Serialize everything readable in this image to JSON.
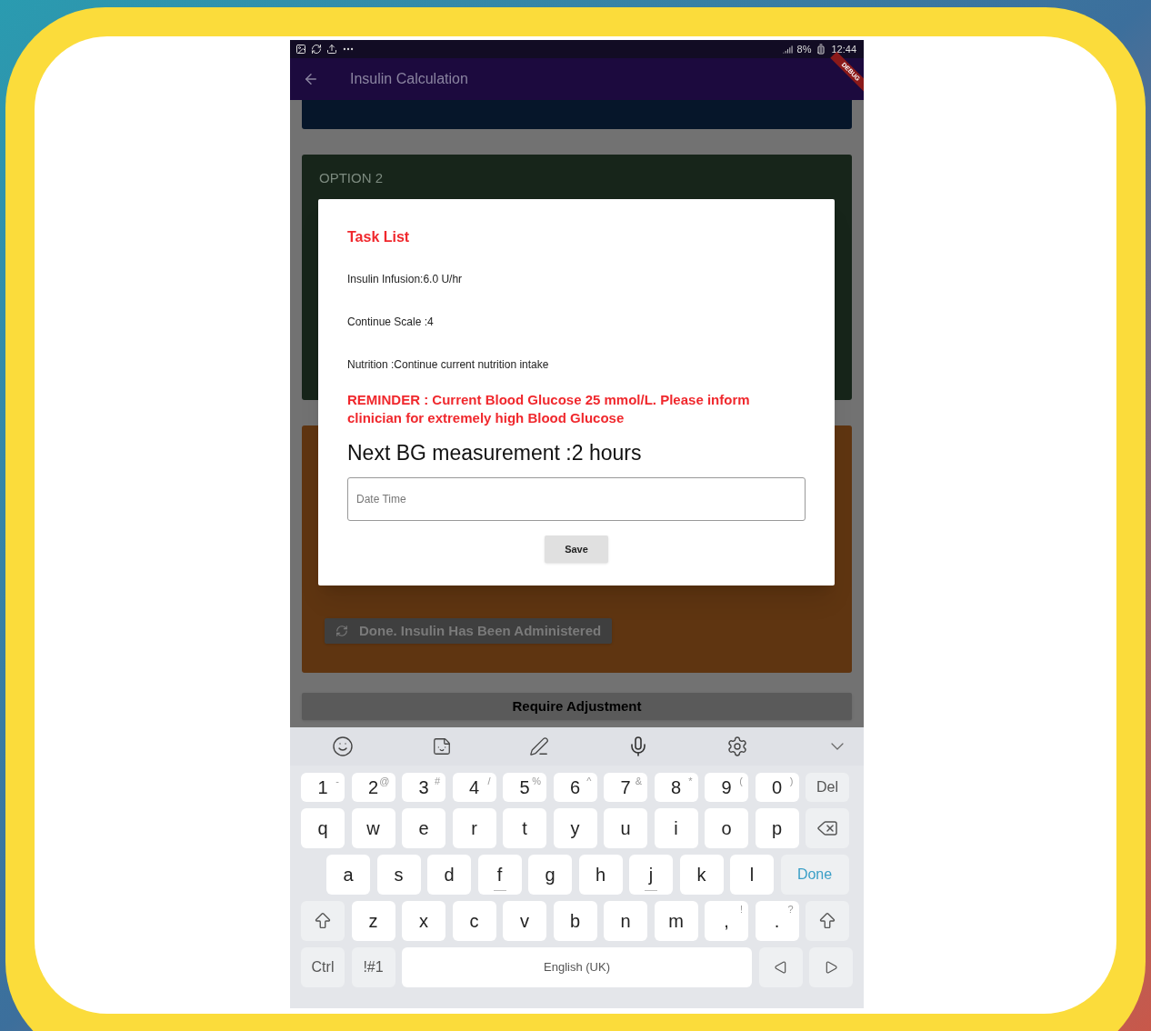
{
  "status_bar": {
    "battery": "8%",
    "time": "12:44"
  },
  "debug_banner": "DEBUG",
  "app_bar": {
    "title": "Insulin Calculation"
  },
  "option_card": {
    "label": "OPTION 2"
  },
  "administered_button": {
    "label": "Done. Insulin Has Been Administered",
    "disabled": true
  },
  "adjust_button": {
    "label": "Require Adjustment"
  },
  "dialog": {
    "title": "Task List",
    "lines": [
      "Insulin Infusion:6.0 U/hr",
      "Continue Scale :4",
      "Nutrition :Continue current nutrition intake"
    ],
    "reminder": "REMINDER : Current Blood Glucose 25 mmol/L. Please inform clinician for extremely high Blood Glucose",
    "next": "Next BG measurement :2 hours",
    "field": {
      "placeholder": "Date Time"
    },
    "save": "Save"
  },
  "keyboard": {
    "rows": [
      {
        "indented": false,
        "keys": [
          {
            "kind": "char",
            "label": "1",
            "alt": "-"
          },
          {
            "kind": "char",
            "label": "2",
            "alt": "@"
          },
          {
            "kind": "char",
            "label": "3",
            "alt": "#"
          },
          {
            "kind": "char",
            "label": "4",
            "alt": "/"
          },
          {
            "kind": "char",
            "label": "5",
            "alt": "%"
          },
          {
            "kind": "char",
            "label": "6",
            "alt": "^"
          },
          {
            "kind": "char",
            "label": "7",
            "alt": "&"
          },
          {
            "kind": "char",
            "label": "8",
            "alt": "*"
          },
          {
            "kind": "char",
            "label": "9",
            "alt": "("
          },
          {
            "kind": "char",
            "label": "0",
            "alt": ")"
          },
          {
            "kind": "func",
            "label": "Del"
          }
        ]
      },
      {
        "indented": false,
        "keys": [
          {
            "kind": "char",
            "label": "q"
          },
          {
            "kind": "char",
            "label": "w"
          },
          {
            "kind": "char",
            "label": "e"
          },
          {
            "kind": "char",
            "label": "r"
          },
          {
            "kind": "char",
            "label": "t"
          },
          {
            "kind": "char",
            "label": "y"
          },
          {
            "kind": "char",
            "label": "u"
          },
          {
            "kind": "char",
            "label": "i"
          },
          {
            "kind": "char",
            "label": "o"
          },
          {
            "kind": "char",
            "label": "p"
          },
          {
            "kind": "backspace"
          }
        ]
      },
      {
        "indented": true,
        "keys": [
          {
            "kind": "char",
            "label": "a"
          },
          {
            "kind": "char",
            "label": "s"
          },
          {
            "kind": "char",
            "label": "d"
          },
          {
            "kind": "home",
            "label": "f"
          },
          {
            "kind": "char",
            "label": "g"
          },
          {
            "kind": "char",
            "label": "h"
          },
          {
            "kind": "home",
            "label": "j"
          },
          {
            "kind": "char",
            "label": "k"
          },
          {
            "kind": "char",
            "label": "l"
          },
          {
            "kind": "action",
            "label": "Done"
          }
        ]
      },
      {
        "indented": false,
        "keys": [
          {
            "kind": "shift"
          },
          {
            "kind": "char",
            "label": "z"
          },
          {
            "kind": "char",
            "label": "x"
          },
          {
            "kind": "char",
            "label": "c"
          },
          {
            "kind": "char",
            "label": "v"
          },
          {
            "kind": "char",
            "label": "b"
          },
          {
            "kind": "char",
            "label": "n"
          },
          {
            "kind": "char",
            "label": "m"
          },
          {
            "kind": "char",
            "label": ",",
            "alt": "!"
          },
          {
            "kind": "char",
            "label": ".",
            "alt": "?"
          },
          {
            "kind": "shift"
          }
        ]
      },
      {
        "indented": false,
        "keys": [
          {
            "kind": "func",
            "label": "Ctrl"
          },
          {
            "kind": "func",
            "label": "!#1"
          },
          {
            "kind": "space",
            "label": "English (UK)"
          },
          {
            "kind": "left"
          },
          {
            "kind": "right"
          }
        ]
      }
    ]
  }
}
